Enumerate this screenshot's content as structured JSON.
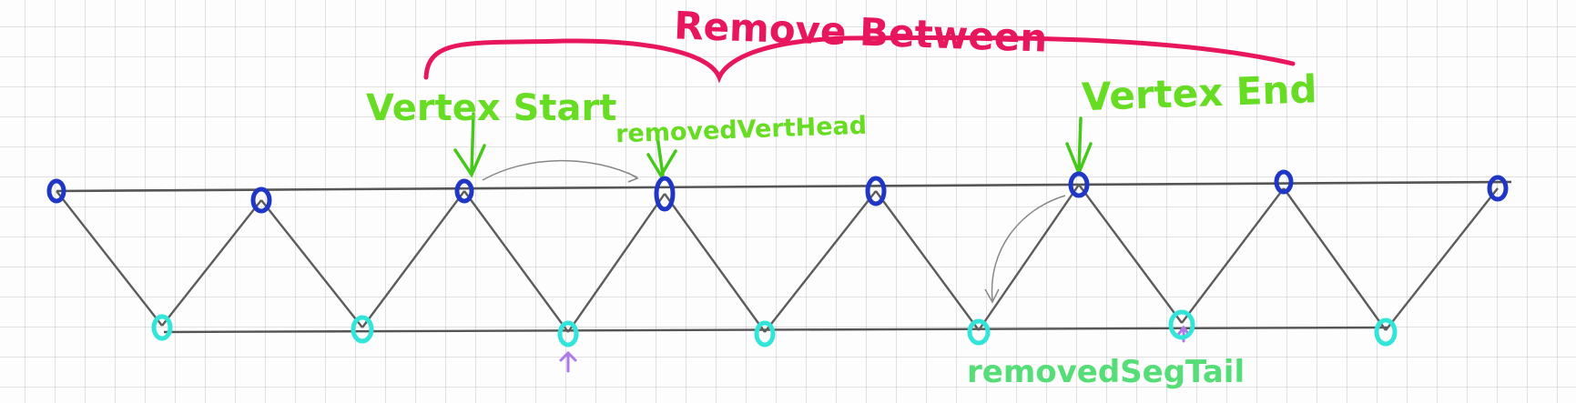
{
  "labels": {
    "title": "Remove Between",
    "vertex_start": "Vertex Start",
    "removed_vert_head": "removedVertHead",
    "vertex_end": "Vertex End",
    "removed_seg_tail": "removedSegTail"
  },
  "colors": {
    "title": "#e8175d",
    "labels": "#66dd22",
    "seg_tail_label": "#55dd77",
    "top_vertex": "#1f37c4",
    "bottom_vertex": "#33e5d8",
    "edge": "#555555",
    "marker": "#b077e8"
  },
  "top_vertex_count": 8,
  "bottom_vertex_count": 7
}
